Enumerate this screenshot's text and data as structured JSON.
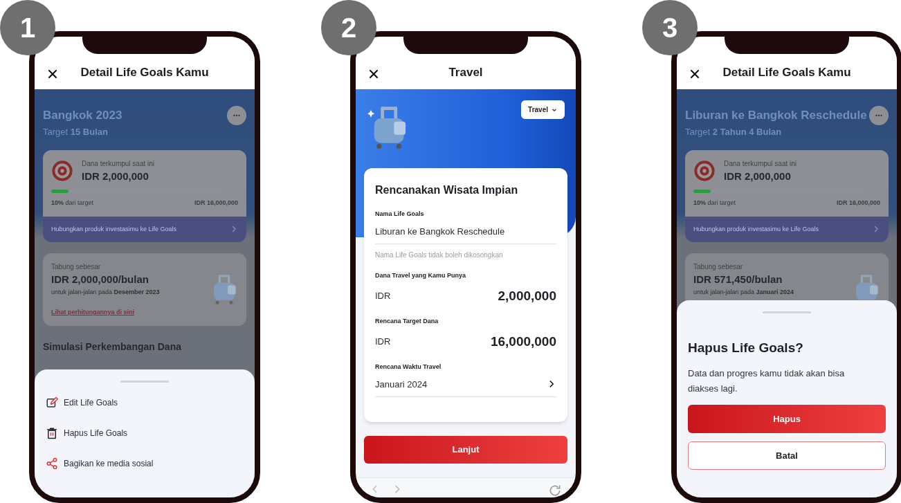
{
  "screens": [
    {
      "kind": "goal_detail",
      "badge": "1",
      "title": "Detail Life Goals Kamu",
      "goal": {
        "name": "Bangkok 2023",
        "target": "Target **15 Bulan**",
        "collected_label": "Dana terkumpul saat ini",
        "collected": "IDR 2,000,000",
        "level": 0.1,
        "progress": "**10%** dari target",
        "target_amount": "IDR 16,000,000",
        "link_banner": "Hubungkan produk investasimu ke Life Goals",
        "save_label": "Tabung sebesar",
        "save_amount": "IDR 2,000,000/bulan",
        "save_note": "untuk jalan-jalan pada **Desember 2023**",
        "calc_link": "Lihat perhitungannya di sini",
        "section_title": "Simulasi Perkembangan Dana"
      },
      "sheet": {
        "kind": "menu",
        "items": [
          {
            "kind": "edit",
            "label": "Edit Life Goals"
          },
          {
            "kind": "delete",
            "label": "Hapus Life Goals"
          },
          {
            "kind": "share",
            "label": "Bagikan ke media sosial"
          }
        ]
      }
    },
    {
      "kind": "form",
      "badge": "2",
      "title": "Travel",
      "category": "Travel",
      "card_title": "Rencanakan Wisata Impian",
      "fields": [
        {
          "kind": "text",
          "label": "Nama Life Goals",
          "value": "Liburan ke Bangkok Reschedule",
          "helper": "Nama Life Goals tidak boleh dikosongkan"
        },
        {
          "kind": "amount",
          "label": "Dana Travel yang Kamu Punya",
          "currency": "IDR",
          "value": "2,000,000"
        },
        {
          "kind": "amount",
          "label": "Rencana Target Dana",
          "currency": "IDR",
          "value": "16,000,000"
        },
        {
          "kind": "select",
          "label": "Rencana Waktu Travel",
          "value": "Januari 2024"
        }
      ],
      "button": "Lanjut"
    },
    {
      "kind": "goal_detail",
      "badge": "3",
      "title": "Detail Life Goals Kamu",
      "goal": {
        "name": "Liburan ke Bangkok Reschedule",
        "target": "Target **2 Tahun 4 Bulan**",
        "collected_label": "Dana terkumpul saat ini",
        "collected": "IDR 2,000,000",
        "level": 0.1,
        "progress": "**10%** dari target",
        "target_amount": "IDR 16,000,000",
        "link_banner": "Hubungkan produk investasimu ke Life Goals",
        "save_label": "Tabung sebesar",
        "save_amount": "IDR 571,450/bulan",
        "save_note": "untuk jalan-jalan pada **Januari 2024**"
      },
      "sheet": {
        "kind": "confirm",
        "title": "Hapus Life Goals?",
        "message": "Data dan progres kamu tidak akan bisa diakses lagi.",
        "buttons": [
          {
            "kind": "primary",
            "label": "Hapus"
          },
          {
            "kind": "secondary",
            "label": "Batal"
          }
        ]
      }
    }
  ]
}
